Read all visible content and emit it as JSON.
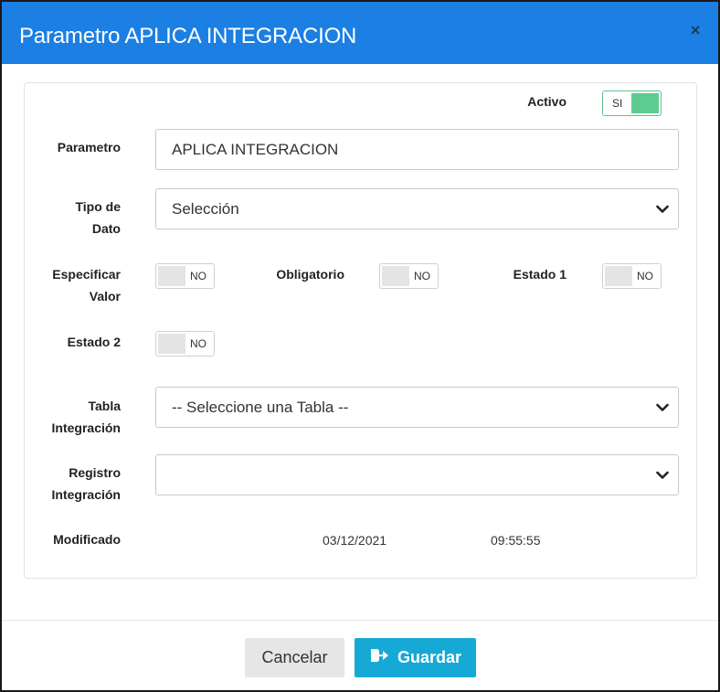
{
  "modal": {
    "title": "Parametro APLICA INTEGRACION",
    "close_label": "×"
  },
  "activo": {
    "label": "Activo",
    "state_text": "SI",
    "on": true
  },
  "parametro": {
    "label": "Parametro",
    "value": "APLICA INTEGRACION"
  },
  "tipo_dato": {
    "label_line1": "Tipo de",
    "label_line2": "Dato",
    "selected": "Selección"
  },
  "especificar_valor": {
    "label_line1": "Especificar",
    "label_line2": "Valor",
    "state_text": "NO",
    "on": false
  },
  "obligatorio": {
    "label": "Obligatorio",
    "state_text": "NO",
    "on": false
  },
  "estado1": {
    "label": "Estado 1",
    "state_text": "NO",
    "on": false
  },
  "estado2": {
    "label": "Estado 2",
    "state_text": "NO",
    "on": false
  },
  "tabla_integracion": {
    "label_line1": "Tabla",
    "label_line2": "Integración",
    "selected": "-- Seleccione una Tabla --"
  },
  "registro_integracion": {
    "label_line1": "Registro",
    "label_line2": "Integración",
    "selected": ""
  },
  "modificado": {
    "label": "Modificado",
    "date": "03/12/2021",
    "time": "09:55:55"
  },
  "footer": {
    "cancel_label": "Cancelar",
    "save_label": "Guardar"
  },
  "colors": {
    "header": "#1b7fe3",
    "toggle_on": "#5fcc8f",
    "save_button": "#17a9d6"
  }
}
